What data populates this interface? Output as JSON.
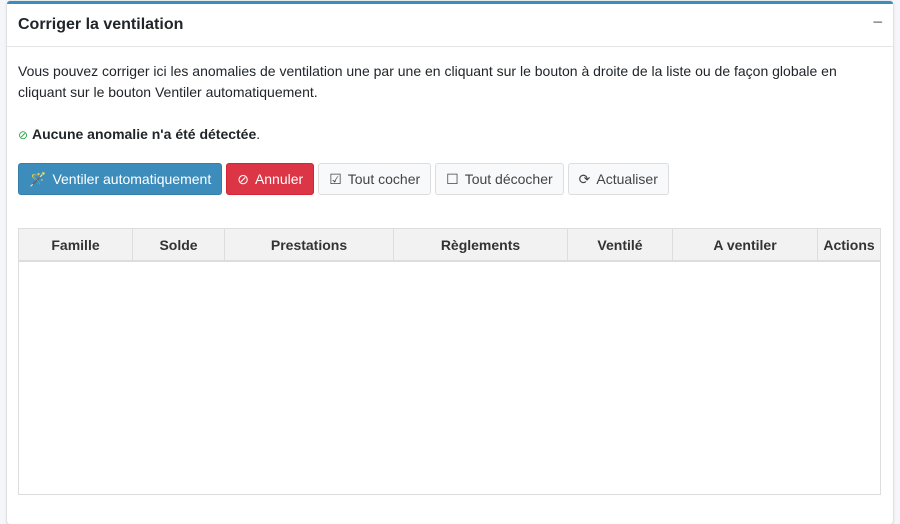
{
  "card": {
    "title": "Corriger la ventilation",
    "collapse_icon": "minus"
  },
  "intro": "Vous pouvez corriger ici les anomalies de ventilation une par une en cliquant sur le bouton à droite de la liste ou de façon globale en cliquant sur le bouton Ventiler automatiquement.",
  "status": {
    "icon": "check-circle",
    "bold": "Aucune anomalie n'a été détectée",
    "tail": "."
  },
  "buttons": {
    "auto": "Ventiler automatiquement",
    "cancel": "Annuler",
    "check_all": "Tout cocher",
    "uncheck_all": "Tout décocher",
    "refresh": "Actualiser"
  },
  "table": {
    "columns": [
      "Famille",
      "Solde",
      "Prestations",
      "Règlements",
      "Ventilé",
      "A ventiler",
      "Actions"
    ]
  },
  "colors": {
    "accent": "#3c8dbc",
    "danger": "#dc3545",
    "success": "#28a745"
  }
}
